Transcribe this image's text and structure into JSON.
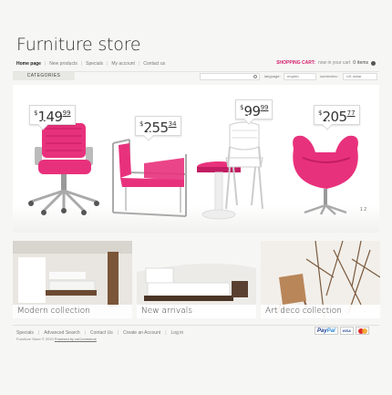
{
  "header": {
    "logo": "Furniture store",
    "nav": [
      "Home page",
      "New products",
      "Specials",
      "My account",
      "Contact us"
    ],
    "cart": {
      "title": "SHOPPING CART:",
      "text": "now in your cart",
      "count": "0",
      "items_label": "items"
    }
  },
  "toolbar": {
    "categories_label": "CATEGORIES",
    "search_placeholder": "",
    "language_label": "language:",
    "language_value": "english",
    "currency_label": "currencies:",
    "currency_value": "US dollar"
  },
  "hero": {
    "prices": [
      {
        "currency": "$",
        "whole": "149",
        "cents": "99"
      },
      {
        "currency": "$",
        "whole": "255",
        "cents": "34"
      },
      {
        "currency": "$",
        "whole": "99",
        "cents": "99"
      },
      {
        "currency": "$",
        "whole": "205",
        "cents": "77"
      }
    ],
    "slider_pages": "1  2",
    "colors": {
      "accent": "#e8317c",
      "accent_dark": "#c21d63"
    }
  },
  "banners": [
    {
      "label": "Modern collection"
    },
    {
      "label": "New arrivals"
    },
    {
      "label": "Art deco collection"
    }
  ],
  "footer": {
    "nav": [
      "Specials",
      "Advanced Search",
      "Contact Us",
      "Create an Account",
      "Log in"
    ],
    "copyright": "Furniture Store © 2010",
    "powered": "Powered by osCommerce",
    "payments": {
      "paypal_a": "Pay",
      "paypal_b": "Pal",
      "visa": "VISA"
    }
  }
}
